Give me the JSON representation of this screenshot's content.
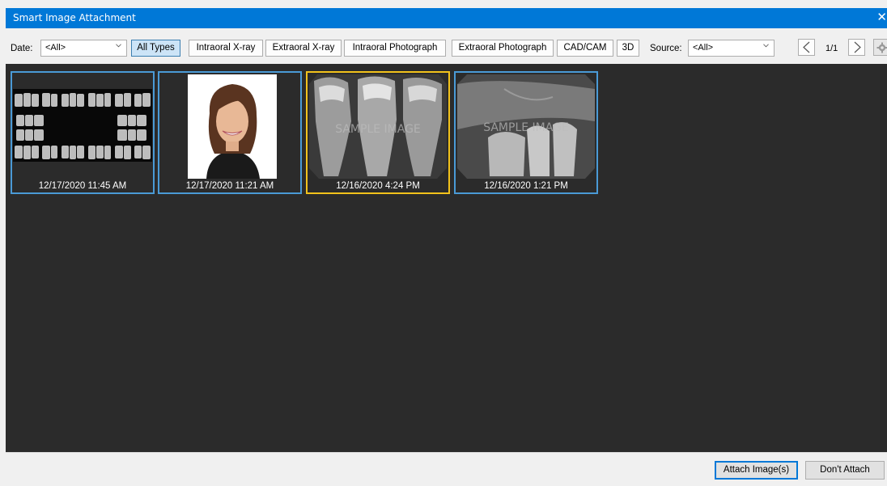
{
  "window": {
    "title": "Smart Image Attachment",
    "close_glyph": "✕"
  },
  "toolbar": {
    "date_label": "Date:",
    "date_value": "<All>",
    "type_filters": [
      "All Types",
      "Intraoral X-ray",
      "Extraoral X-ray",
      "Intraoral Photograph",
      "Extraoral Photograph",
      "CAD/CAM",
      "3D"
    ],
    "active_filter": "All Types",
    "source_label": "Source:",
    "source_value": "<All>",
    "page_indicator": "1/1"
  },
  "images": [
    {
      "caption": "12/17/2020 11:45 AM",
      "kind": "full-mouth-series",
      "selected": false
    },
    {
      "caption": "12/17/2020 11:21 AM",
      "kind": "patient-photo",
      "selected": false
    },
    {
      "caption": "12/16/2020 4:24 PM",
      "kind": "periapical-xray",
      "selected": true,
      "watermark": "SAMPLE IMAGE"
    },
    {
      "caption": "12/16/2020 1:21 PM",
      "kind": "periapical-xray",
      "selected": false,
      "watermark": "SAMPLE IMAGE"
    }
  ],
  "footer": {
    "attach_label": "Attach Image(s)",
    "dont_attach_label": "Don't Attach"
  },
  "colors": {
    "titlebar": "#0078d7",
    "thumb_border": "#4a9ad6",
    "thumb_selected_border": "#f2c21b",
    "gallery_bg": "#2b2b2b"
  }
}
